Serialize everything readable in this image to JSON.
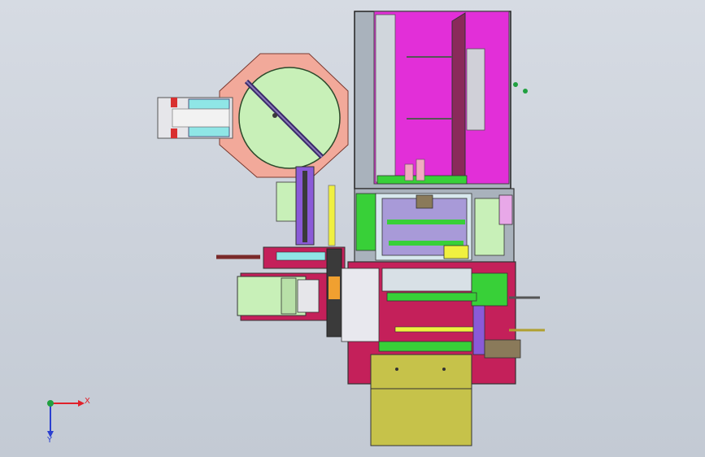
{
  "viewport": {
    "background_top": "#d6dbe3",
    "background_bottom": "#c3cad4"
  },
  "triad": {
    "x_label": "X",
    "y_label": "Y",
    "x_color": "#e0202a",
    "y_color": "#2a3fd0",
    "origin_color": "#20a040"
  },
  "colors": {
    "salmon": "#f2a99a",
    "light_green": "#c8f0b8",
    "magenta": "#e22fd8",
    "crimson": "#c4205a",
    "olive": "#c6c24a",
    "cyan": "#8fe6e6",
    "green": "#38d038",
    "purple": "#8a5ad8",
    "yellow": "#f0f040",
    "gray_frame": "#a9b2bc",
    "dark": "#3a3a3a"
  }
}
